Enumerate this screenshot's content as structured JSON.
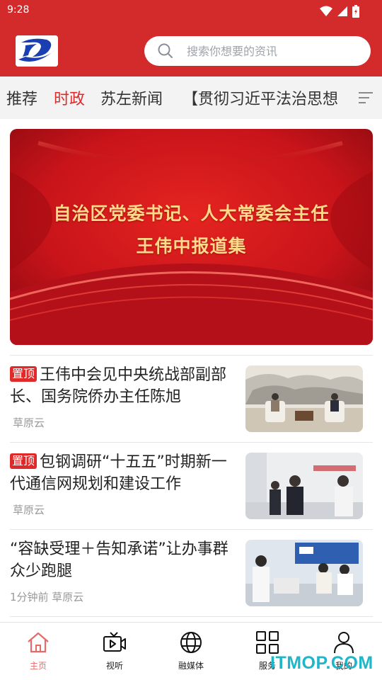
{
  "status_bar": {
    "time": "9:28"
  },
  "header": {
    "search": {
      "placeholder": "搜索你想要的资讯"
    }
  },
  "tabs": [
    {
      "label": "推荐",
      "active": false
    },
    {
      "label": "时政",
      "active": true
    },
    {
      "label": "苏左新闻",
      "active": false
    },
    {
      "label": "【贯彻习近平法治思想",
      "active": false
    }
  ],
  "banner": {
    "line1": "自治区党委书记、人大常委会主任",
    "line2": "王伟中报道集"
  },
  "news": [
    {
      "badge": "置顶",
      "title": "王伟中会见中央统战部副部长、国务院侨办主任陈旭",
      "meta": "草原云"
    },
    {
      "badge": "置顶",
      "title": "包钢调研“十五五”时期新一代通信网规划和建设工作",
      "meta": "草原云"
    },
    {
      "badge": "",
      "title": "“容缺受理＋告知承诺”让办事群众少跑腿",
      "meta": "1分钟前 草原云"
    }
  ],
  "bottom_nav": [
    {
      "label": "主页",
      "icon": "home-icon",
      "active": true
    },
    {
      "label": "视听",
      "icon": "video-icon",
      "active": false
    },
    {
      "label": "融媒体",
      "icon": "globe-icon",
      "active": false
    },
    {
      "label": "服务",
      "icon": "grid-icon",
      "active": false
    },
    {
      "label": "我的",
      "icon": "user-icon",
      "active": false
    }
  ],
  "watermark": "ITMOP.COM",
  "colors": {
    "brand_red": "#d32b2b",
    "accent_red": "#e02a2a",
    "nav_active": "#e56b6b"
  }
}
